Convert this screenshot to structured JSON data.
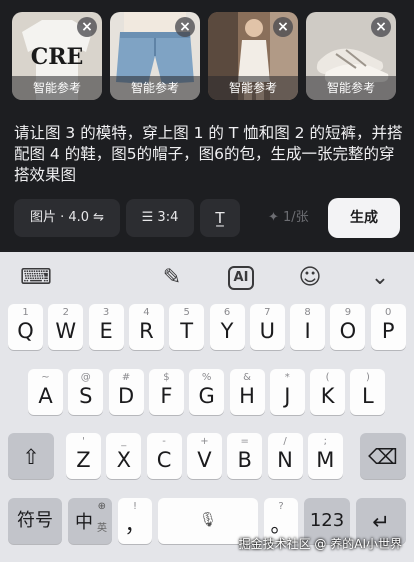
{
  "composer": {
    "thumbnails": [
      {
        "tag": "智能参考"
      },
      {
        "tag": "智能参考"
      },
      {
        "tag": "智能参考"
      },
      {
        "tag": "智能参考"
      }
    ],
    "remove_glyph": "×",
    "prompt_text": "请让图 3 的模特，穿上图 1 的 T 恤和图 2 的短裤，并搭配图 4 的鞋，图5的帽子，图6的包，生成一张完整的穿搭效果图",
    "model_pill": "图片 · 4.0 ⇋",
    "ratio_pill": "☰ 3:4",
    "text_pill": "T̲",
    "cost": "✦ 1/张",
    "generate_label": "生成"
  },
  "keyboard": {
    "toolbar": {
      "icons": [
        "keyboard-settings-icon",
        "brush-icon",
        "ai-icon",
        "emoji-icon",
        "collapse-icon"
      ],
      "glyphs": [
        "⌨",
        "✎",
        "AI",
        "☺",
        "⌄"
      ]
    },
    "row1": [
      {
        "k": "Q",
        "s": "1"
      },
      {
        "k": "W",
        "s": "2"
      },
      {
        "k": "E",
        "s": "3"
      },
      {
        "k": "R",
        "s": "4"
      },
      {
        "k": "T",
        "s": "5"
      },
      {
        "k": "Y",
        "s": "6"
      },
      {
        "k": "U",
        "s": "7"
      },
      {
        "k": "I",
        "s": "8"
      },
      {
        "k": "O",
        "s": "9"
      },
      {
        "k": "P",
        "s": "0"
      }
    ],
    "row2": [
      {
        "k": "A",
        "s": "~"
      },
      {
        "k": "S",
        "s": "@"
      },
      {
        "k": "D",
        "s": "#"
      },
      {
        "k": "F",
        "s": "$"
      },
      {
        "k": "G",
        "s": "%"
      },
      {
        "k": "H",
        "s": "&"
      },
      {
        "k": "J",
        "s": "*"
      },
      {
        "k": "K",
        "s": "("
      },
      {
        "k": "L",
        "s": ")"
      }
    ],
    "row3": [
      {
        "k": "Z",
        "s": "'"
      },
      {
        "k": "X",
        "s": "_"
      },
      {
        "k": "C",
        "s": "-"
      },
      {
        "k": "V",
        "s": "+"
      },
      {
        "k": "B",
        "s": "="
      },
      {
        "k": "N",
        "s": "/"
      },
      {
        "k": "M",
        "s": ";"
      }
    ],
    "shift_glyph": "⇧",
    "backspace_glyph": "⌫",
    "symbols_label": "符号",
    "lang_label": "中",
    "lang_sub": "英",
    "globe_glyph": "⊕",
    "comma": "，",
    "comma_sup": "!",
    "mic_glyph": "🎙",
    "period": "。",
    "period_sup": "?",
    "num_label": "123",
    "enter_glyph": "↵"
  },
  "watermark": "掘金技术社区 @ 养的AI小世界",
  "colors": {
    "panel": "#1d1e21",
    "keyboard": "#e4e5e9",
    "key": "#fdfdfd",
    "key_dark": "#c2c4ca"
  }
}
